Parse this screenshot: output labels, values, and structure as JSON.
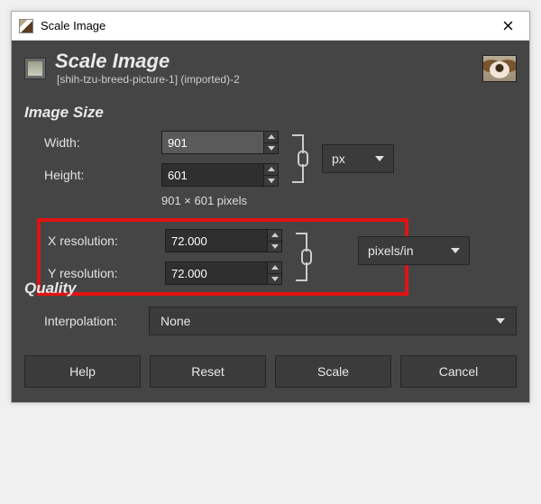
{
  "window": {
    "title": "Scale Image"
  },
  "header": {
    "title": "Scale Image",
    "subtitle": "[shih-tzu-breed-picture-1] (imported)-2"
  },
  "image_size": {
    "section_label": "Image Size",
    "width_label": "Width:",
    "width_value": "901",
    "height_label": "Height:",
    "height_value": "601",
    "dimensions_text": "901 × 601 pixels",
    "unit": "px"
  },
  "resolution": {
    "x_label": "X resolution:",
    "x_value": "72.000",
    "y_label": "Y resolution:",
    "y_value": "72.000",
    "unit": "pixels/in"
  },
  "quality": {
    "section_label": "Quality",
    "interpolation_label": "Interpolation:",
    "interpolation_value": "None"
  },
  "buttons": {
    "help": "Help",
    "reset": "Reset",
    "scale": "Scale",
    "cancel": "Cancel"
  }
}
